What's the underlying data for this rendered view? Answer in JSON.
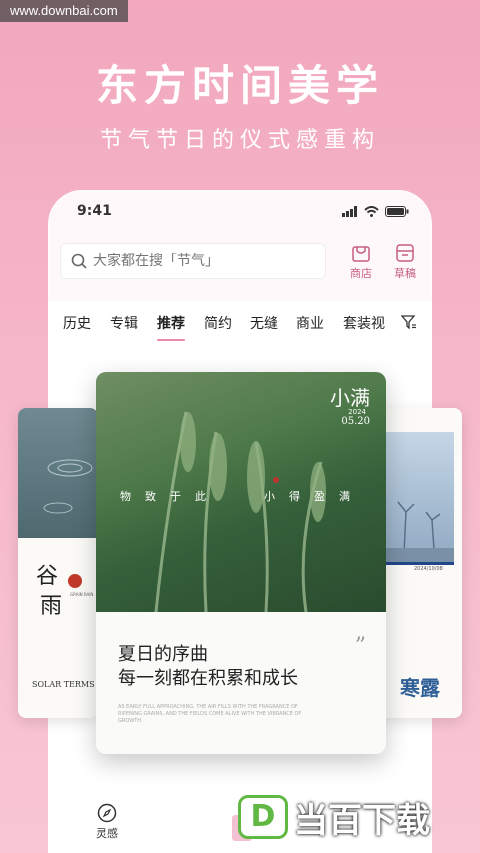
{
  "watermark": "www.downbai.com",
  "hero": {
    "title": "东方时间美学",
    "subtitle": "节气节日的仪式感重构"
  },
  "statusbar": {
    "time": "9:41"
  },
  "search": {
    "placeholder": "大家都在搜「节气」"
  },
  "top_actions": [
    {
      "label": "商店",
      "icon": "shop-icon"
    },
    {
      "label": "草稿",
      "icon": "draft-icon"
    }
  ],
  "tabs": [
    "历史",
    "专辑",
    "推荐",
    "简约",
    "无缝",
    "商业",
    "套装视"
  ],
  "active_tab": "推荐",
  "main_card": {
    "term": "小满",
    "year": "2024",
    "date": "05.20",
    "proverb_left": "物致于此",
    "proverb_right": "小得盈满",
    "line1": "夏日的序曲",
    "line2": "每一刻都在积累和成长",
    "small_text": "AS EARLY FULL APPROACHING, THE AIR FILLS WITH THE FRAGRANCE OF RIPENING GRAINS, AND THE FIELDS COME ALIVE WITH THE VIBRANCE OF GROWTH."
  },
  "left_card": {
    "title_line1": "谷",
    "title_line2": "雨",
    "seal": "GRAIN RAIN",
    "footer": "SOLAR TERMS"
  },
  "right_card": {
    "date": "2024/10/08",
    "title": "寒露"
  },
  "bottom_nav": [
    {
      "label": "灵感",
      "icon": "compass-icon"
    }
  ],
  "logo": {
    "letter": "D",
    "text": "当百下载"
  },
  "colors": {
    "accent": "#e98aa6",
    "background": "#f5b6c8"
  }
}
